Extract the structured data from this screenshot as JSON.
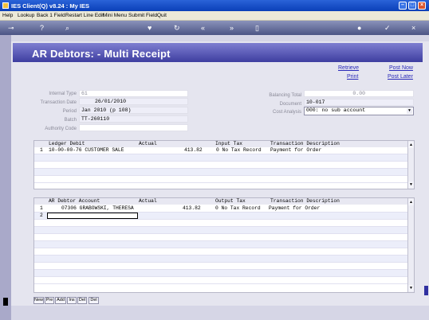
{
  "window": {
    "title": "IES Client(Q) v8.24 : My IES"
  },
  "menu": [
    "Help",
    "Lookup",
    "Back 1 Field",
    "Restart Line Edit",
    "Mini Menu",
    "Submit Field",
    "Quit"
  ],
  "toolbar_icons": [
    "key-icon",
    "help-icon",
    "search-icon",
    "heart-icon",
    "refresh-icon",
    "rewind-icon",
    "fast-forward-icon",
    "document-icon",
    "globe-icon",
    "check-icon",
    "close-icon"
  ],
  "page": {
    "title": "AR Debtors: - Multi Receipt"
  },
  "links": {
    "retrieve": "Retrieve",
    "post_now": "Post Now",
    "print": "Print",
    "post_later": "Post Later"
  },
  "form": {
    "internal_type_label": "Internal Type",
    "internal_type": "61",
    "transaction_date_label": "Transaction Date",
    "transaction_date": "26/01/2010",
    "period_label": "Period",
    "period": "Jan 2010 (p 108)",
    "batch_label": "Batch",
    "batch": "TT-260110",
    "authority_code_label": "Authority Code",
    "authority_code": "",
    "balancing_total_label": "Balancing Total",
    "balancing_total": "0.00",
    "document_label": "Document",
    "document": "10-017",
    "cost_analysis_label": "Cost Analysis",
    "cost_analysis": "000: no sub account"
  },
  "ledger_grid": {
    "headers": [
      "Ledger Debit",
      "Actual",
      "Input Tax",
      "Transaction Description"
    ],
    "rows": [
      {
        "num": "1",
        "account": "10-00-00-76 CUSTOMER SALE",
        "actual": "413.82",
        "tax": "0 No Tax Record",
        "desc": "Payment for Order"
      }
    ]
  },
  "debtor_grid": {
    "headers": [
      "AR Debtor Account",
      "Actual",
      "Output Tax",
      "Transaction Description"
    ],
    "rows": [
      {
        "num": "1",
        "account": "07306 GRABOWSKI, THERESA",
        "actual": "413.82",
        "tax": "0 No Tax Record",
        "desc": "Payment for Order"
      },
      {
        "num": "2",
        "account": "",
        "actual": "",
        "tax": "",
        "desc": ""
      }
    ]
  },
  "buttons": {
    "new": "New",
    "pre": "Pre",
    "add": "Add",
    "ins": "Ins",
    "del_a": "Del",
    "del_b": "Del"
  }
}
